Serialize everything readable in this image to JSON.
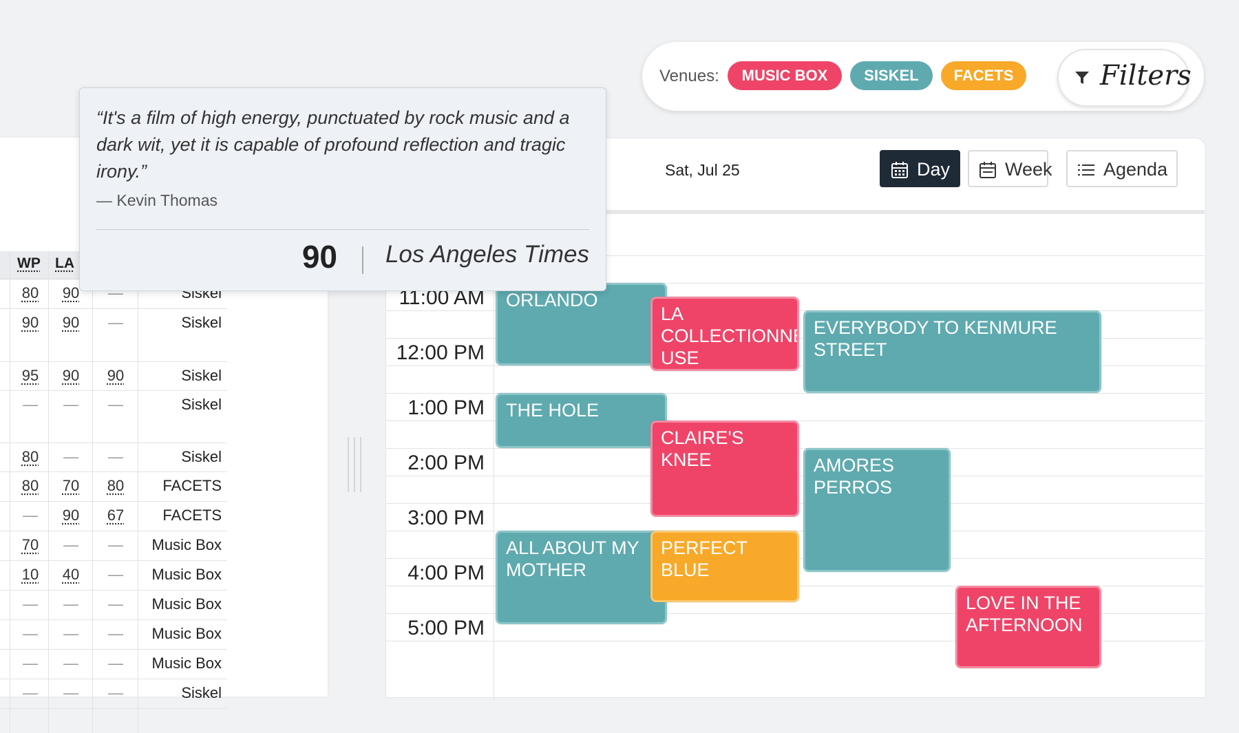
{
  "venues": {
    "label": "Venues:",
    "chips": [
      {
        "label": "MUSIC BOX",
        "color": "#ef4468"
      },
      {
        "label": "SISKEL",
        "color": "#5eaaaf"
      },
      {
        "label": "FACETS",
        "color": "#f8a929"
      }
    ],
    "filters_label": "Filters"
  },
  "calendar": {
    "date": "Sat, Jul 25",
    "views": [
      {
        "label": "Day",
        "active": true
      },
      {
        "label": "Week",
        "active": false
      },
      {
        "label": "Agenda",
        "active": false
      }
    ],
    "times": [
      "11:00 AM",
      "12:00 PM",
      "1:00 PM",
      "2:00 PM",
      "3:00 PM",
      "4:00 PM",
      "5:00 PM"
    ],
    "events": [
      {
        "title": "ORLANDO",
        "venue": "Siskel"
      },
      {
        "title": "LA COLLECTIONNE USE",
        "venue": "Music Box"
      },
      {
        "title": "EVERYBODY TO KENMURE STREET",
        "venue": "Siskel"
      },
      {
        "title": "THE HOLE",
        "venue": "Siskel"
      },
      {
        "title": "CLAIRE'S KNEE",
        "venue": "Music Box"
      },
      {
        "title": "AMORES PERROS",
        "venue": "Siskel"
      },
      {
        "title": "ALL ABOUT MY MOTHER",
        "venue": "Siskel"
      },
      {
        "title": "PERFECT BLUE",
        "venue": "Facets"
      },
      {
        "title": "LOVE IN THE AFTERNOON",
        "venue": "Music Box"
      }
    ]
  },
  "table": {
    "headers": [
      "WP",
      "LA"
    ],
    "rows": [
      {
        "wp": "80",
        "la": "90",
        "c3": "—",
        "venue": "Siskel"
      },
      {
        "wp": "90",
        "la": "90",
        "c3": "—",
        "venue": "Siskel"
      },
      {
        "wp": "95",
        "la": "90",
        "c3": "90",
        "venue": "Siskel"
      },
      {
        "wp": "—",
        "la": "—",
        "c3": "—",
        "venue": "Siskel"
      },
      {
        "wp": "80",
        "la": "—",
        "c3": "—",
        "venue": "Siskel"
      },
      {
        "wp": "80",
        "la": "70",
        "c3": "80",
        "venue": "FACETS"
      },
      {
        "wp": "—",
        "la": "90",
        "c3": "67",
        "venue": "FACETS"
      },
      {
        "wp": "70",
        "la": "—",
        "c3": "—",
        "venue": "Music Box"
      },
      {
        "wp": "10",
        "la": "40",
        "c3": "—",
        "venue": "Music Box"
      },
      {
        "wp": "—",
        "la": "—",
        "c3": "—",
        "venue": "Music Box"
      },
      {
        "wp": "—",
        "la": "—",
        "c3": "—",
        "venue": "Music Box"
      },
      {
        "wp": "—",
        "la": "—",
        "c3": "—",
        "venue": "Music Box"
      },
      {
        "wp": "—",
        "la": "—",
        "c3": "—",
        "venue": "Siskel"
      }
    ]
  },
  "tooltip": {
    "quote": "“It's a film of high energy, punctuated by rock music and a dark wit, yet it is capable of profound reflection and tragic irony.”",
    "author": "— Kevin Thomas",
    "score": "90",
    "publication": "Los Angeles Times"
  }
}
